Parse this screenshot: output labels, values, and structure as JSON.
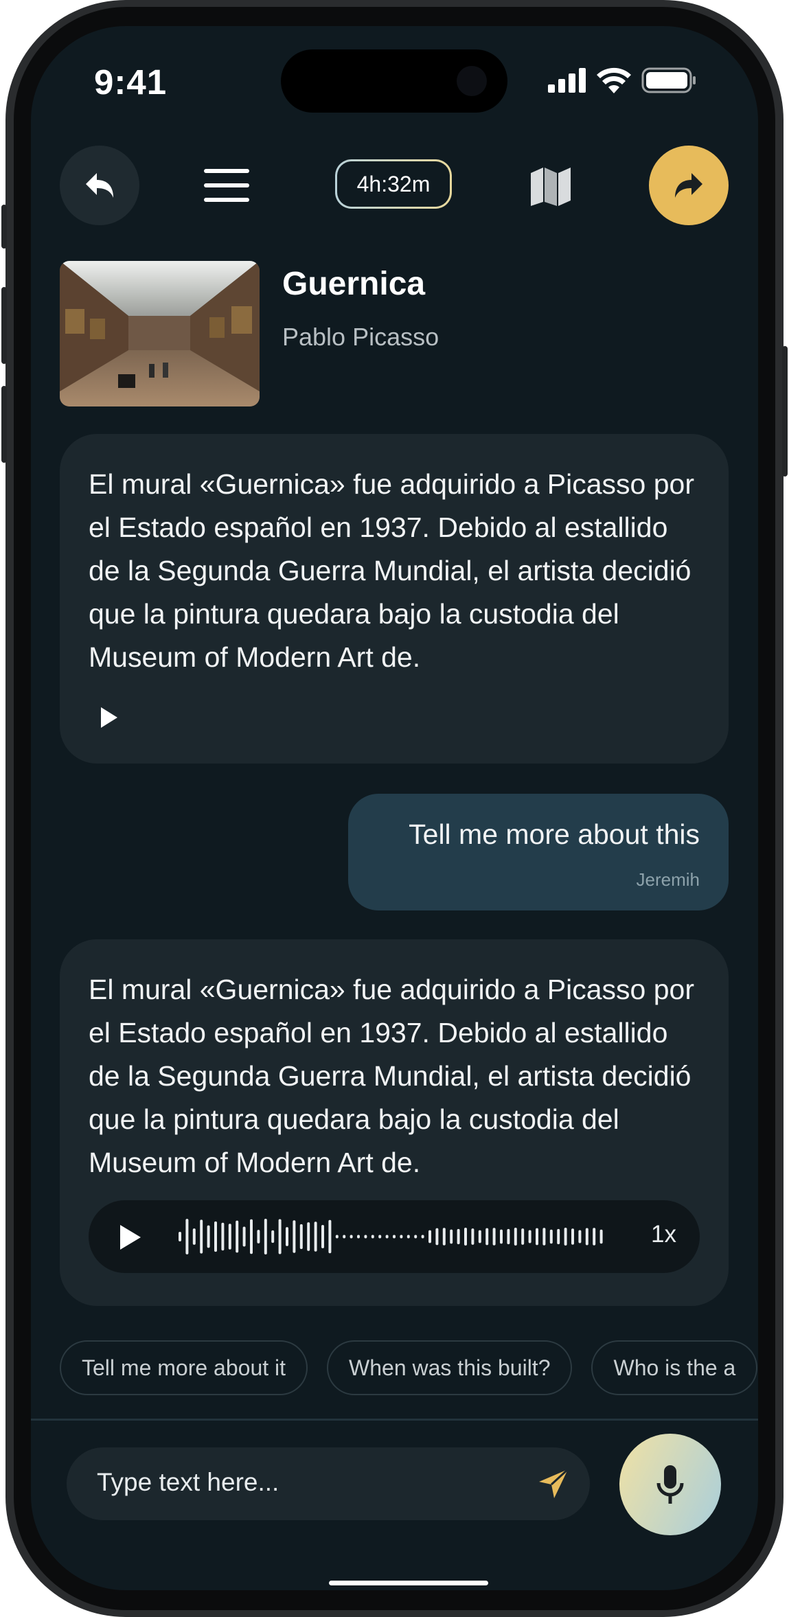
{
  "status": {
    "time": "9:41"
  },
  "toolbar": {
    "timer": "4h:32m"
  },
  "artwork": {
    "title": "Guernica",
    "artist": "Pablo Picasso"
  },
  "messages": [
    {
      "role": "assistant",
      "text": "El mural «Guernica» fue adquirido a Picasso por el Estado español en 1937. Debido al estallido de la Segunda Guerra Mundial, el artista decidió que la pintura quedara bajo la custodia del Museum of Modern Art de."
    },
    {
      "role": "user",
      "text": "Tell me more about this",
      "author": "Jeremih"
    },
    {
      "role": "assistant",
      "text": "El mural «Guernica» fue adquirido a Picasso por el Estado español en 1937. Debido al estallido de la Segunda Guerra Mundial, el artista decidió que la pintura quedara bajo la custodia del Museum of Modern Art de.",
      "audio_speed": "1x"
    }
  ],
  "suggestions": [
    "Tell me more about it",
    "When was this built?",
    "Who is the a"
  ],
  "composer": {
    "placeholder": "Type text here..."
  },
  "colors": {
    "accent": "#e7bb5b",
    "background": "#0f1a20",
    "bubble": "#1c272d",
    "user_bubble": "#233d4b"
  }
}
